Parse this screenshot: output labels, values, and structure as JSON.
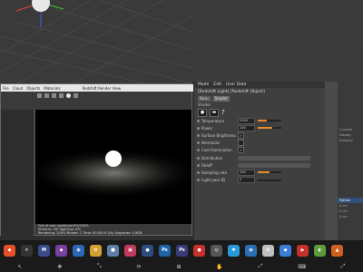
{
  "attr": {
    "menu": [
      "Mode",
      "Edit",
      "User Data"
    ],
    "title": "[Redshift Light] [Redshift Object]",
    "tabs": [
      "Basic",
      "Shader"
    ],
    "section": "Shader",
    "props": [
      {
        "label": "Temperature",
        "value": "2500",
        "fill": 0.4
      },
      {
        "label": "Power",
        "value": "100",
        "fill": 0.6
      },
      {
        "label": "Surface Brightness",
        "check": true
      },
      {
        "label": "Normalize",
        "check": false
      },
      {
        "label": "Cast Illumination",
        "check": true
      },
      {
        "label": "Distribution",
        "combo": true
      },
      {
        "label": "Falloff",
        "combo": true
      },
      {
        "label": "Sampling rate",
        "value": "100",
        "fill": 0.5
      },
      {
        "label": "Light pass ID",
        "value": "0",
        "fill": 0.0
      }
    ]
  },
  "render": {
    "menu": [
      "File",
      "Cloud",
      "Objects",
      "Materials"
    ],
    "title": "Redshift Render View",
    "status": [
      "Out of core used/max:0%/100%",
      "Shdr/Lib: 0/0          Rgb/Uvw: 0/0",
      "Rendering: 100%  Mutate: 1  Time: 00:00:00 (0s)  Upgrades: 0.8GB"
    ]
  },
  "right_panel": {
    "labels": [
      "Console",
      "Python"
    ],
    "items": [
      "Display",
      "Drawing"
    ],
    "fields": [
      "0 cm",
      "0 cm",
      "0 cm"
    ]
  },
  "colors": {
    "accent": "#e78c2d",
    "axis_x": "#e04040",
    "axis_y": "#40c040",
    "axis_z": "#4060e0",
    "glow": "#ffffff"
  }
}
